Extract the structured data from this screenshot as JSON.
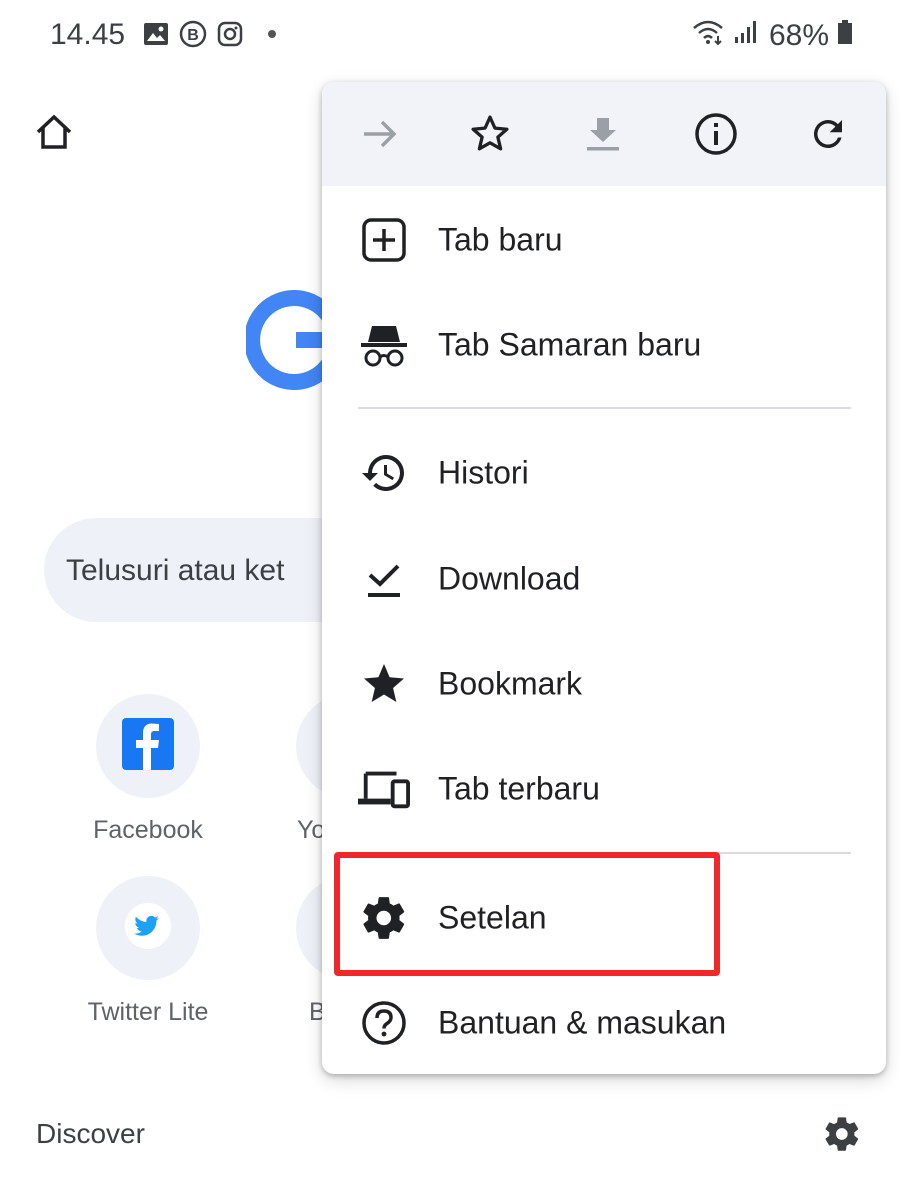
{
  "status_bar": {
    "time": "14.45",
    "battery": "68%",
    "icons": [
      "gallery-icon",
      "b-icon",
      "instagram-icon",
      "dot-icon",
      "wifi-icon",
      "signal-icon",
      "battery-icon"
    ]
  },
  "page": {
    "search_placeholder": "Telusuri atau ket",
    "shortcuts": [
      {
        "label": "Facebook",
        "icon": "facebook-icon"
      },
      {
        "label": "Yo",
        "icon": "youtube-icon"
      },
      {
        "label": "Twitter Lite",
        "icon": "twitter-icon"
      },
      {
        "label": "B",
        "icon": "bookmark-icon"
      }
    ],
    "discover_label": "Discover"
  },
  "menu": {
    "toolbar": [
      "forward-icon",
      "bookmark-star-icon",
      "download-icon",
      "info-icon",
      "reload-icon"
    ],
    "items": [
      {
        "label": "Tab baru",
        "icon": "new-tab-icon"
      },
      {
        "label": "Tab Samaran baru",
        "icon": "incognito-icon"
      },
      {
        "label": "Histori",
        "icon": "history-icon"
      },
      {
        "label": "Download",
        "icon": "download-done-icon"
      },
      {
        "label": "Bookmark",
        "icon": "star-icon"
      },
      {
        "label": "Tab terbaru",
        "icon": "devices-icon"
      },
      {
        "label": "Setelan",
        "icon": "settings-icon"
      },
      {
        "label": "Bantuan & masukan",
        "icon": "help-icon"
      }
    ]
  },
  "colors": {
    "highlight": "#f0282d",
    "google_blue": "#4285f4",
    "facebook_blue": "#1877f2",
    "twitter_blue": "#1da1f2"
  }
}
